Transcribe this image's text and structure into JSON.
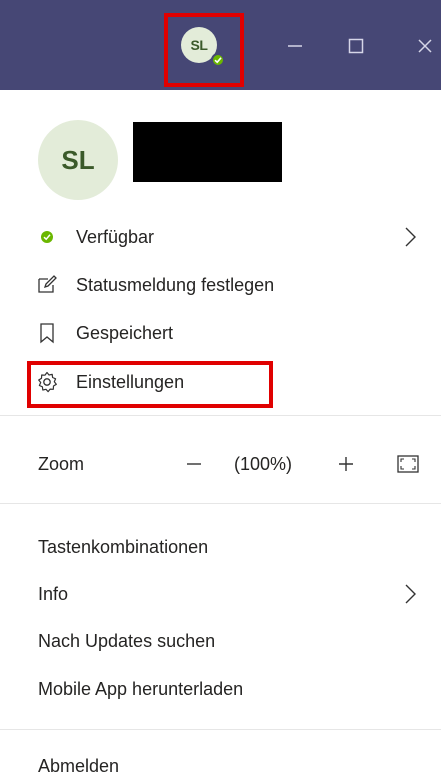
{
  "titlebar": {
    "avatar_initials": "SL",
    "presence": "available",
    "buttons": [
      "minimize-icon",
      "maximize-icon",
      "close-icon"
    ],
    "background": "#464775"
  },
  "profile": {
    "initials": "SL",
    "name_redacted": true
  },
  "menu": {
    "status": {
      "label": "Verfügbar",
      "icon": "status-available-dot",
      "color": "#6bb700"
    },
    "status_message": {
      "label": "Statusmeldung festlegen",
      "icon": "edit-message-icon"
    },
    "saved": {
      "label": "Gespeichert",
      "icon": "bookmark-icon"
    },
    "settings": {
      "label": "Einstellungen",
      "icon": "gear-icon"
    }
  },
  "zoom": {
    "label": "Zoom",
    "value": "(100%)"
  },
  "links": {
    "shortcuts": "Tastenkombinationen",
    "info": "Info",
    "updates": "Nach Updates suchen",
    "mobile": "Mobile App herunterladen",
    "signout": "Abmelden"
  },
  "colors": {
    "highlight": "#e00000",
    "presence_green": "#6bb700",
    "avatar_bg": "#e3ecd9"
  }
}
